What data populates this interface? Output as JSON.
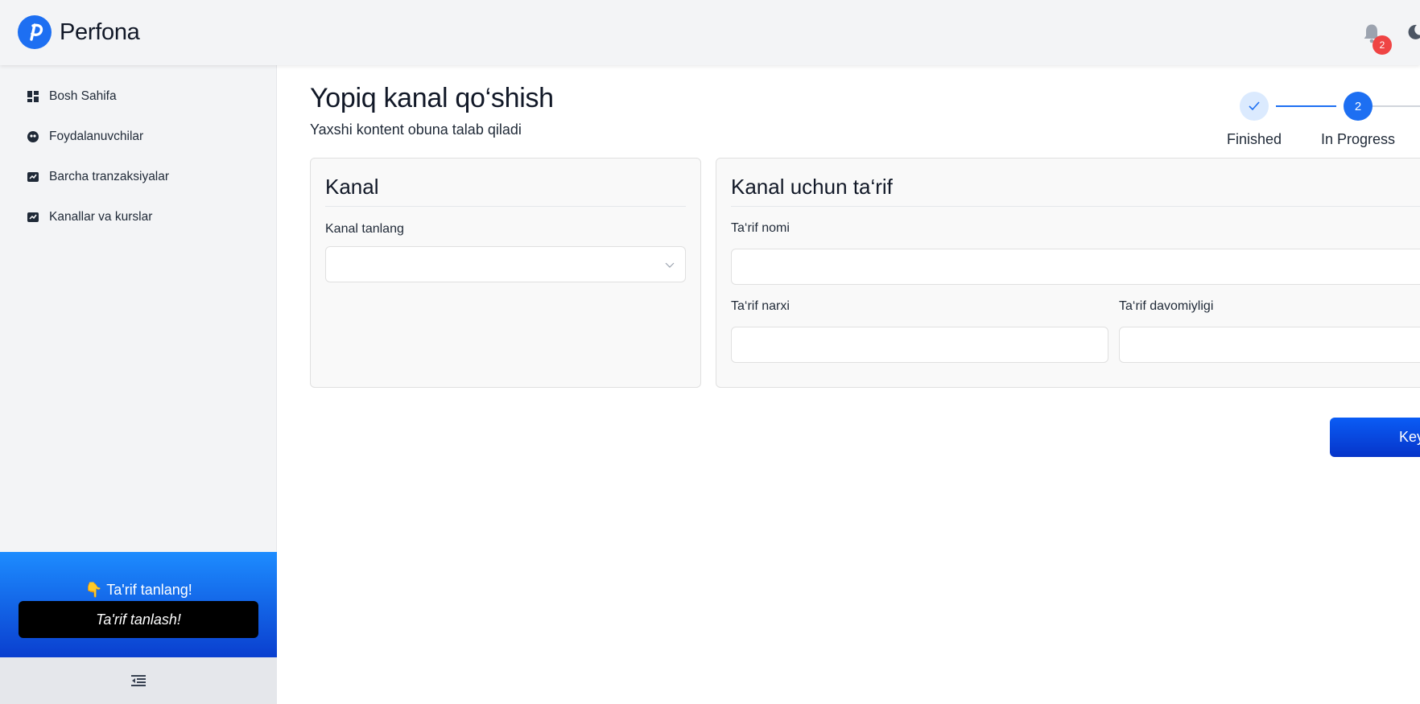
{
  "brand": {
    "name": "Perfona",
    "accent": "#1d6ff2"
  },
  "header": {
    "notifications_count": "2",
    "bell_icon": "bell-icon",
    "theme_icon": "moon-icon"
  },
  "sidebar": {
    "items": [
      {
        "label": "Bosh Sahifa",
        "icon": "dashboard-icon"
      },
      {
        "label": "Foydalanuvchilar",
        "icon": "users-icon"
      },
      {
        "label": "Barcha tranzaksiyalar",
        "icon": "transactions-icon"
      },
      {
        "label": "Kanallar va kurslar",
        "icon": "channels-icon"
      }
    ],
    "promo": {
      "text": "👇 Ta'rif tanlang!",
      "button": "Ta'rif tanlash!"
    },
    "collapse_icon": "collapse-menu-icon"
  },
  "page": {
    "title": "Yopiq kanal qo‘shish",
    "subtitle": "Yaxshi kontent obuna talab qiladi"
  },
  "stepper": {
    "steps": [
      {
        "label": "Finished",
        "status": "done"
      },
      {
        "label": "In Progress",
        "number": "2",
        "status": "active"
      }
    ]
  },
  "channel_card": {
    "title": "Kanal",
    "select_label": "Kanal tanlang",
    "select_value": ""
  },
  "tariff_card": {
    "title": "Kanal uchun ta‘rif",
    "name_label": "Ta‘rif nomi",
    "name_value": "",
    "price_label": "Ta‘rif narxi",
    "price_value": "",
    "duration_label": "Ta‘rif davomiyligi",
    "duration_value": ""
  },
  "actions": {
    "next_label": "Key"
  }
}
